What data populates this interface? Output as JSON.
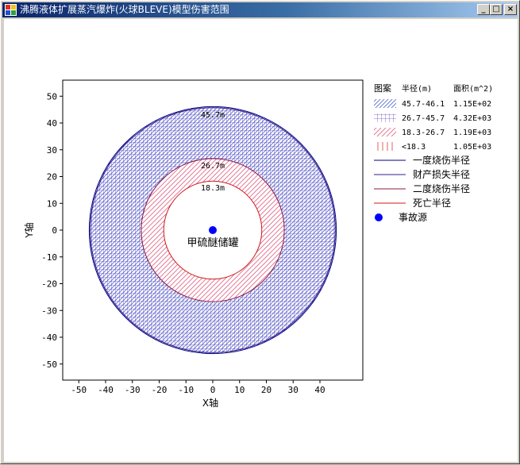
{
  "window": {
    "title": "沸腾液体扩展蒸汽爆炸(火球BLEVE)模型伤害范围",
    "minimize_glyph": "_",
    "maximize_glyph": "□",
    "close_glyph": "×"
  },
  "chart_data": {
    "type": "scatter",
    "xlabel": "X轴",
    "ylabel": "Y轴",
    "xlim": [
      -56,
      56
    ],
    "ylim": [
      -56,
      56
    ],
    "xticks": [
      -50,
      -40,
      -30,
      -20,
      -10,
      0,
      10,
      20,
      30,
      40
    ],
    "yticks": [
      50,
      40,
      30,
      20,
      10,
      0,
      -10,
      -20,
      -30,
      -40,
      -50
    ],
    "grid": false,
    "legend_position": "right",
    "circles": [
      {
        "name": "一度烧伤半径",
        "radius": 46.1,
        "color": "#000080"
      },
      {
        "name": "财产损失半径",
        "radius": 45.7,
        "color": "#3a1f8c"
      },
      {
        "name": "二度烧伤半径",
        "radius": 26.7,
        "color": "#8b1a4a"
      },
      {
        "name": "死亡半径",
        "radius": 18.3,
        "color": "#d01818"
      }
    ],
    "circle_labels": [
      {
        "text": "45.7m",
        "radius": 45.7
      },
      {
        "text": "26.7m",
        "radius": 26.7
      },
      {
        "text": "18.3m",
        "radius": 18.3
      }
    ],
    "zones": [
      {
        "range": "45.7-46.1",
        "area": "1.15E+02",
        "pattern": "diag-blue",
        "color": "#5a6fd0"
      },
      {
        "range": "26.7-45.7",
        "area": "4.32E+03",
        "pattern": "grid-purple",
        "color": "#6a4fc0"
      },
      {
        "range": "18.3-26.7",
        "area": "1.19E+03",
        "pattern": "diag-pink",
        "color": "#e06a8a"
      },
      {
        "range": "<18.3",
        "area": "1.05E+03",
        "pattern": "vert-red",
        "color": "#e05050"
      }
    ],
    "source": {
      "name": "甲硫醚储罐",
      "x": 0,
      "y": 0,
      "color": "#0000ff",
      "legend": "事故源"
    },
    "legend_header": {
      "pattern": "图案",
      "radius": "半径(m)",
      "area": "面积(m^2)"
    }
  }
}
